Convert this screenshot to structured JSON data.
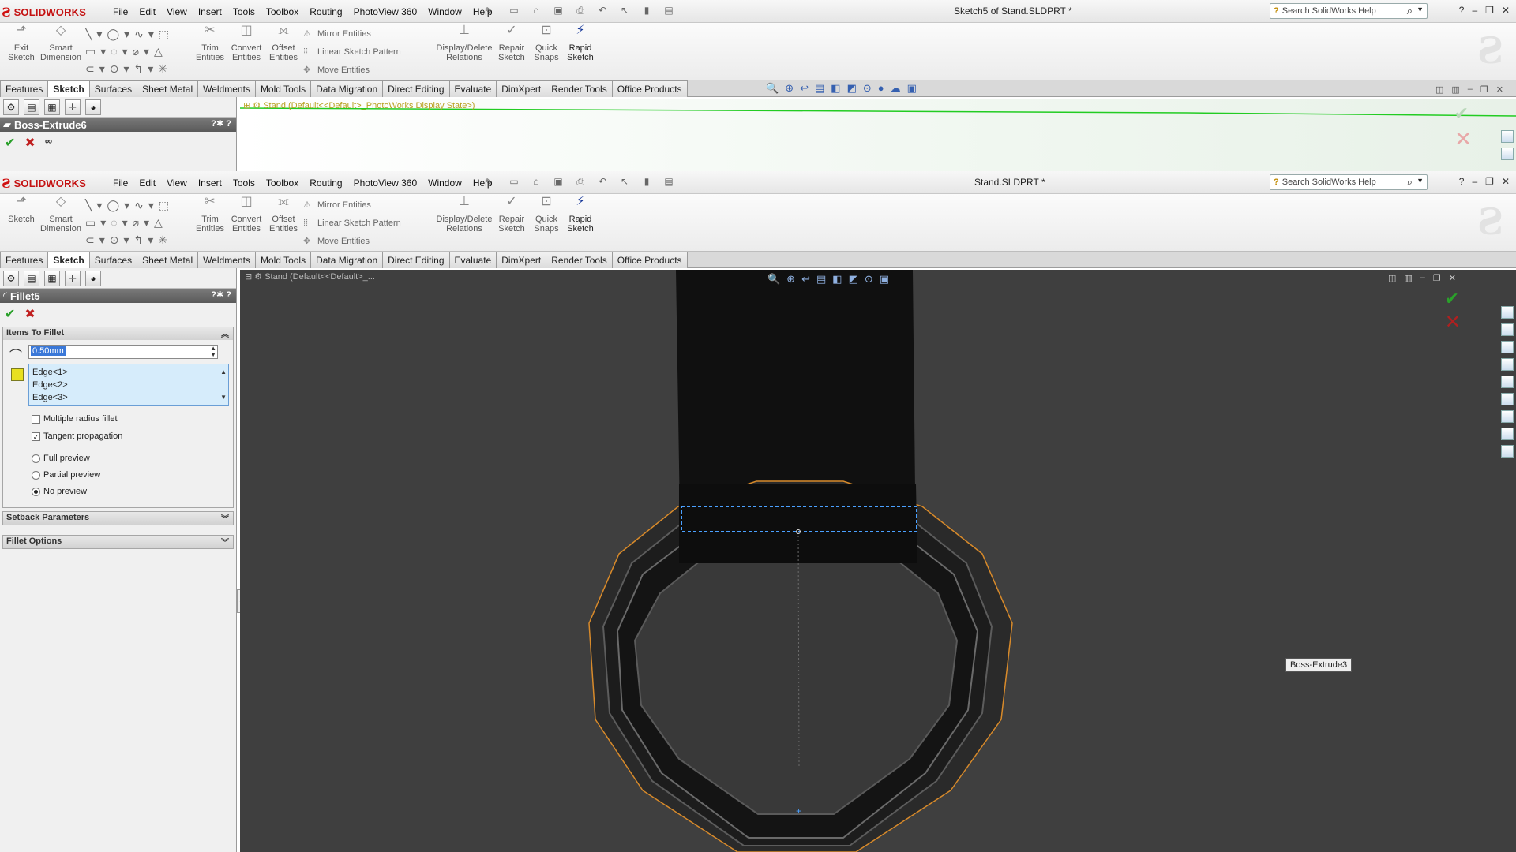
{
  "app": {
    "brand": "SOLIDWORKS"
  },
  "menu": [
    "File",
    "Edit",
    "View",
    "Insert",
    "Tools",
    "Toolbox",
    "Routing",
    "PhotoView 360",
    "Window",
    "Help"
  ],
  "window1": {
    "title": "Sketch5 of Stand.SLDPRT *",
    "search_placeholder": "Search SolidWorks Help",
    "ribbon": {
      "exit_sketch": "Exit Sketch",
      "smart_dimension": "Smart Dimension",
      "trim": "Trim Entities",
      "convert": "Convert Entities",
      "offset": "Offset Entities",
      "mirror": "Mirror Entities",
      "linear_pattern": "Linear Sketch Pattern",
      "move": "Move Entities",
      "display_relations": "Display/Delete Relations",
      "repair": "Repair Sketch",
      "quick_snaps": "Quick Snaps",
      "rapid": "Rapid Sketch"
    },
    "tabs": [
      "Features",
      "Sketch",
      "Surfaces",
      "Sheet Metal",
      "Weldments",
      "Mold Tools",
      "Data Migration",
      "Direct Editing",
      "Evaluate",
      "DimXpert",
      "Render Tools",
      "Office Products"
    ],
    "active_tab": "Sketch",
    "pm_title": "Boss-Extrude6",
    "tree_text": "Stand (Default<<Default>_PhotoWorks Display State>)"
  },
  "window2": {
    "title": "Stand.SLDPRT *",
    "search_placeholder": "Search SolidWorks Help",
    "ribbon": {
      "exit_sketch": "Sketch",
      "smart_dimension": "Smart Dimension",
      "trim": "Trim Entities",
      "convert": "Convert Entities",
      "offset": "Offset Entities",
      "mirror": "Mirror Entities",
      "linear_pattern": "Linear Sketch Pattern",
      "move": "Move Entities",
      "display_relations": "Display/Delete Relations",
      "repair": "Repair Sketch",
      "quick_snaps": "Quick Snaps",
      "rapid": "Rapid Sketch"
    },
    "tabs": [
      "Features",
      "Sketch",
      "Surfaces",
      "Sheet Metal",
      "Weldments",
      "Mold Tools",
      "Data Migration",
      "Direct Editing",
      "Evaluate",
      "DimXpert",
      "Render Tools",
      "Office Products"
    ],
    "active_tab": "Sketch",
    "pm_title": "Fillet5",
    "tree_text": "Stand (Default<<Default>_...",
    "items_to_fillet": {
      "header": "Items To Fillet",
      "radius": "0.50mm",
      "edges": [
        "Edge<1>",
        "Edge<2>",
        "Edge<3>"
      ],
      "multiple_radius": "Multiple radius fillet",
      "multiple_radius_checked": false,
      "tangent": "Tangent propagation",
      "tangent_checked": true,
      "preview_options": [
        "Full preview",
        "Partial preview",
        "No preview"
      ],
      "preview_selected": "No preview"
    },
    "setback": "Setback Parameters",
    "fillet_options": "Fillet Options",
    "tooltip": "Boss-Extrude3"
  },
  "colors": {
    "accent": "#c41212",
    "viewport_bg": "#3f3f3f",
    "ok_green": "#2aa02a",
    "cancel_red": "#c02020",
    "selection": "#4aa0ff",
    "edge_highlight": "#d88a2a"
  }
}
